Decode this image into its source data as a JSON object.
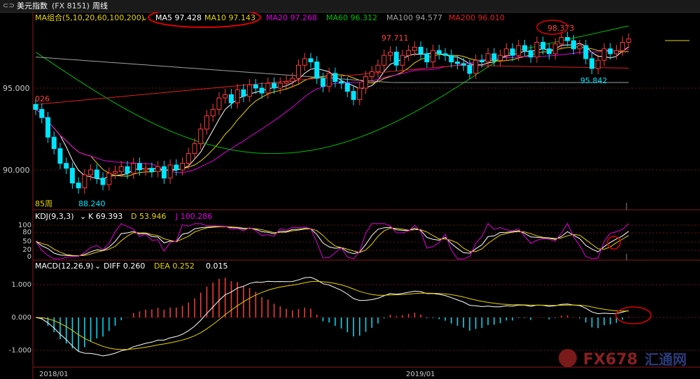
{
  "header": {
    "icon": "link-icon",
    "title": "美元指数",
    "code": "(FX 8151)",
    "period": "周线"
  },
  "main_panel": {
    "legend_prefix": "MA组合(5,10,20,60,100,200)",
    "ma": [
      {
        "label": "MA5 97.428",
        "color": "#ffffff"
      },
      {
        "label": "MA10 97.143",
        "color": "#e8d400"
      },
      {
        "label": "MA20 97.268",
        "color": "#e000e0"
      },
      {
        "label": "MA60 96.312",
        "color": "#00c000"
      },
      {
        "label": "MA100 94.577",
        "color": "#a0a0a0"
      },
      {
        "label": "MA200 96.010",
        "color": "#e02020"
      }
    ],
    "y_ticks": [
      "95.000",
      "90.000"
    ],
    "annotations": {
      "high_2019": "98.373",
      "mid_high": "97.711",
      "recent_low": "95.842",
      "start_value": "026",
      "low_value": "88.240",
      "low_label": "85周"
    }
  },
  "kdj_panel": {
    "legend_prefix": "KDJ(9,3,3)",
    "k": "K 69.393",
    "d": "D 53.946",
    "j": "J 100.286",
    "y_ticks": [
      "100",
      "80",
      "50",
      "20",
      "0"
    ]
  },
  "macd_panel": {
    "legend_prefix": "MACD(12,26,9)",
    "diff": "DIFF 0.260",
    "dea": "DEA 0.252",
    "macd": "0.015",
    "y_ticks": [
      "1.000",
      "0.000",
      "-1.000"
    ]
  },
  "x_axis": [
    "2018/01",
    "2019/01"
  ],
  "watermark": {
    "brand": "FX678",
    "cn": "汇通网"
  },
  "colors": {
    "up": "#ff3b3b",
    "down": "#00e5ff",
    "highlight_circle": "#e00000"
  },
  "chart_data": {
    "type": "line",
    "title": "美元指数 周线",
    "ylim": [
      86,
      99.5
    ],
    "y_ticks": [
      95,
      90
    ],
    "x": [
      "2018/01",
      "2019/01"
    ],
    "series": [
      {
        "name": "MA5",
        "values": [
          97.428
        ]
      },
      {
        "name": "MA10",
        "values": [
          97.143
        ]
      },
      {
        "name": "MA20",
        "values": [
          97.268
        ]
      },
      {
        "name": "MA60",
        "values": [
          96.312
        ]
      },
      {
        "name": "MA100",
        "values": [
          94.577
        ]
      },
      {
        "name": "MA200",
        "values": [
          96.01
        ]
      }
    ],
    "price_annotations": [
      {
        "label": "98.373",
        "value": 98.373
      },
      {
        "label": "97.711",
        "value": 97.711
      },
      {
        "label": "95.842",
        "value": 95.842
      },
      {
        "label": "88.240",
        "value": 88.24
      }
    ],
    "indicators": {
      "KDJ": {
        "K": 69.393,
        "D": 53.946,
        "J": 100.286,
        "y_ticks": [
          100,
          80,
          50,
          20,
          0
        ]
      },
      "MACD": {
        "DIFF": 0.26,
        "DEA": 0.252,
        "MACD": 0.015,
        "y_ticks": [
          1.0,
          0.0,
          -1.0
        ]
      }
    }
  }
}
